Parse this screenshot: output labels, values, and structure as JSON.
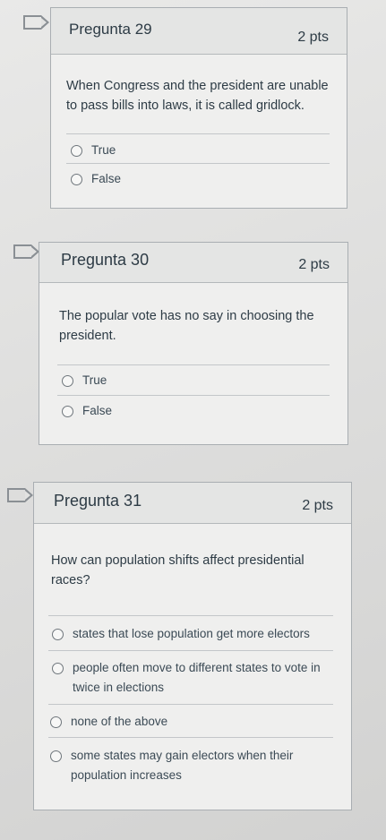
{
  "questions": [
    {
      "title": "Pregunta 29",
      "points": "2 pts",
      "text": "When Congress and the president are unable to pass bills into laws, it is called gridlock.",
      "options": [
        "True",
        "False"
      ]
    },
    {
      "title": "Pregunta 30",
      "points": "2 pts",
      "text": "The popular vote has no say in choosing the president.",
      "options": [
        "True",
        "False"
      ]
    },
    {
      "title": "Pregunta 31",
      "points": "2 pts",
      "text": "How can population shifts affect presidential races?",
      "options": [
        "states that lose population get more electors",
        "people often move to different states to vote in twice in elections",
        "none of the above",
        "some states may gain electors when their population increases"
      ]
    }
  ]
}
